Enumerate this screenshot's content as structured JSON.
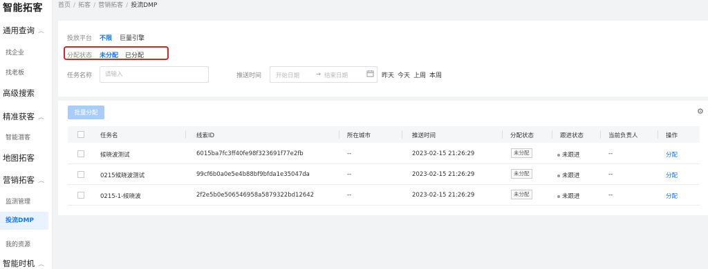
{
  "sidebar": {
    "brand": "智能拓客",
    "groups": {
      "general": "通用查询",
      "advanced": "高级搜索",
      "precise": "精准获客",
      "map": "地图拓客",
      "marketing": "营销拓客",
      "timing": "智能时机"
    },
    "items": {
      "find_company": "找企业",
      "find_boss": "找老板",
      "smart_prospect": "智能潜客",
      "monitor": "监测管理",
      "dmp": "投流DMP",
      "my_resources": "我的资源"
    }
  },
  "breadcrumb": {
    "home": "首页",
    "prospect": "拓客",
    "marketing": "营销拓客",
    "current": "投流DMP",
    "separator": "/"
  },
  "filters": {
    "platform_label": "投放平台",
    "platform_options": [
      "不限",
      "巨量引擎"
    ],
    "allocation_label": "分配状态",
    "allocation_options": [
      "未分配",
      "已分配"
    ],
    "task_name_label": "任务名称",
    "task_name_placeholder": "请输入",
    "push_time_label": "推送时间",
    "start_date_placeholder": "开始日期",
    "date_arrow": "→",
    "end_date_placeholder": "结束日期",
    "quick_dates": [
      "昨天",
      "今天",
      "上周",
      "本周"
    ]
  },
  "toolbar": {
    "batch_assign": "批量分配"
  },
  "table": {
    "headers": [
      "任务名",
      "线索ID",
      "所在城市",
      "推送时间",
      "分配状态",
      "跟进状态",
      "当前负责人",
      "操作"
    ],
    "rows": [
      {
        "task": "候晓波测试",
        "clue_id": "6015ba7fc3ff40fe98f323691f77e2fb",
        "city": "--",
        "push_time": "2023-02-15 21:26:29",
        "alloc": "未分配",
        "follow": "未跟进",
        "owner": "--",
        "action": "分配"
      },
      {
        "task": "0215候晓波测试",
        "clue_id": "99cf6b0a0e5e4b88bf9bfda1e35047da",
        "city": "--",
        "push_time": "2023-02-15 21:26:29",
        "alloc": "未分配",
        "follow": "未跟进",
        "owner": "--",
        "action": "分配"
      },
      {
        "task": "0215-1-候晓波",
        "clue_id": "2f2e5b0e506546958a5879322bd12642",
        "city": "--",
        "push_time": "2023-02-15 21:26:29",
        "alloc": "未分配",
        "follow": "未跟进",
        "owner": "--",
        "action": "分配"
      }
    ]
  },
  "colors": {
    "accent": "#1677ff",
    "highlight_border": "#e02020",
    "active_bg": "#e8f3ff",
    "disabled_button": "#a9cdfa"
  },
  "icons": {
    "chevron": "chevron-up-icon",
    "calendar": "calendar-icon",
    "settings": "gear-icon"
  }
}
